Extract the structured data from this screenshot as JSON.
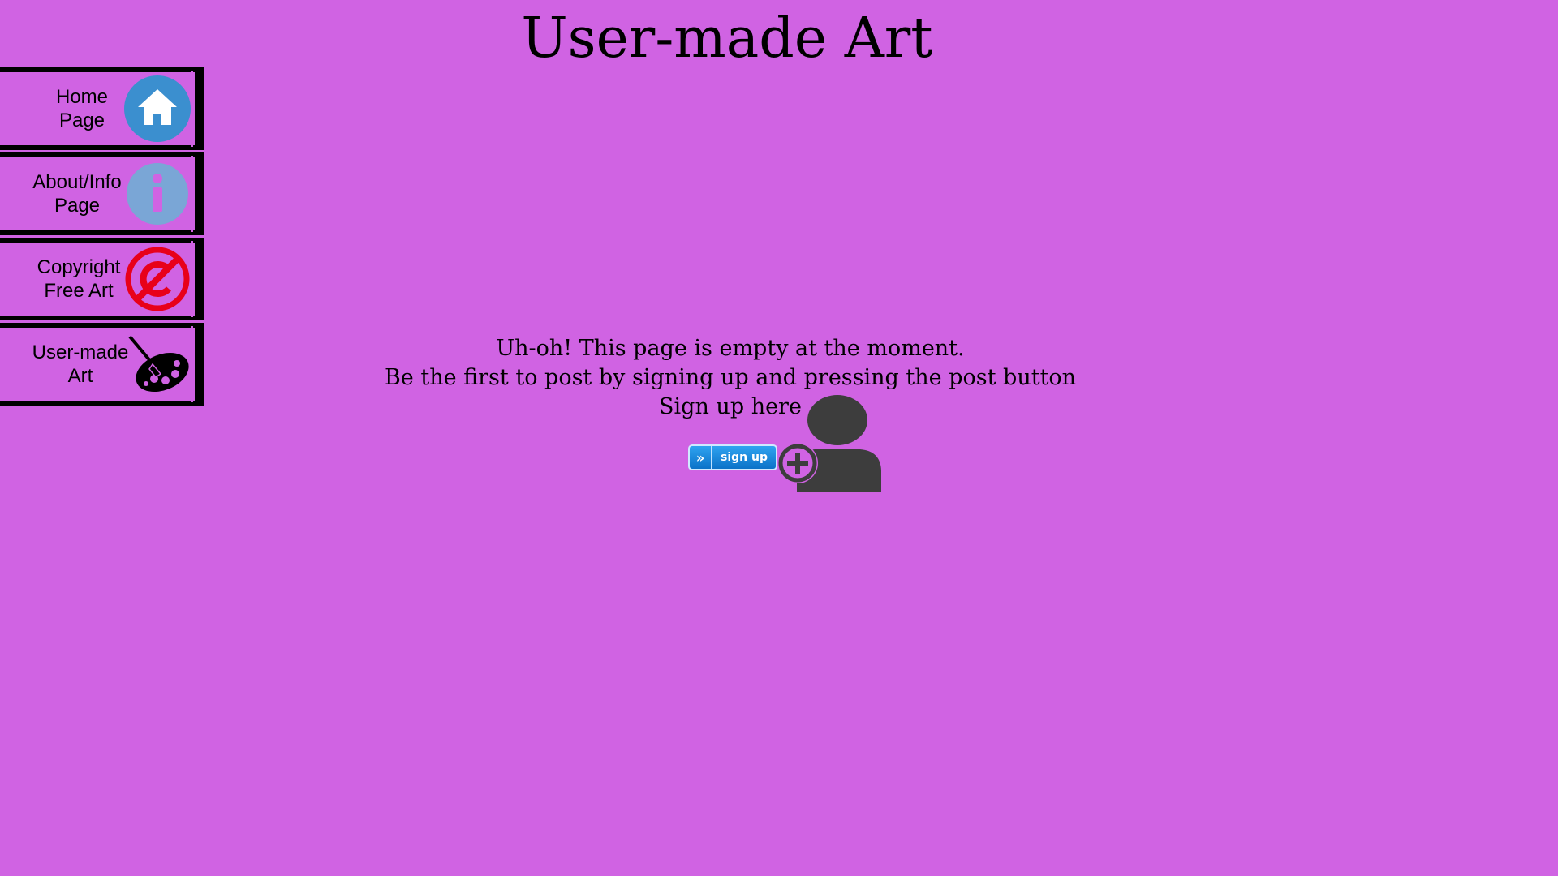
{
  "page": {
    "title": "User-made Art",
    "background": "#d063e3"
  },
  "nav": {
    "items": [
      {
        "label": "Home\nPage",
        "icon": "home-icon"
      },
      {
        "label": "About/Info\nPage",
        "icon": "info-icon"
      },
      {
        "label": "Copyright\nFree Art",
        "icon": "copyright-free-icon"
      },
      {
        "label": "User-made\nArt",
        "icon": "paint-palette-icon"
      }
    ]
  },
  "main": {
    "empty_line1": "Uh-oh! This page is empty at the moment.",
    "empty_line2": "Be the first to post by signing up and pressing the post button",
    "signup_prompt": "Sign up here",
    "signup_button": {
      "chevron": "»",
      "label": "sign up"
    },
    "signup_icon": "add-user-icon"
  }
}
